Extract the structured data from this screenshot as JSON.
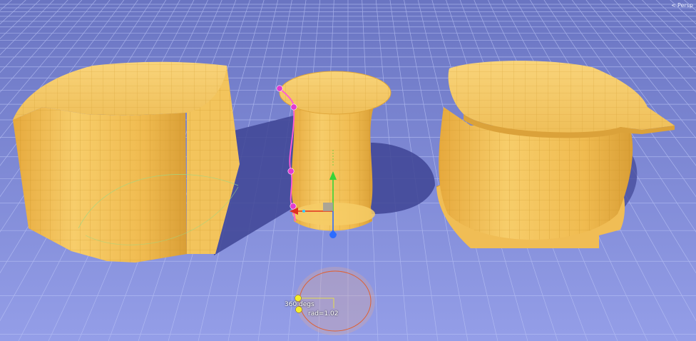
{
  "viewport": {
    "projection_label": "Persp",
    "projection_icon": "camera-arrow-icon"
  },
  "gizmo": {
    "angle_label": "360 degs",
    "radius_label": "rad=1.02"
  },
  "colors": {
    "sky_top": "#6a75c2",
    "sky_bottom": "#949ee8",
    "grid_line": "#b9c2f5",
    "mesh_fill": "#f1bd4f",
    "mesh_light": "#f8d479",
    "mesh_dark": "#d29833",
    "mesh_wire": "#c8921f",
    "shadow": "#3e4494",
    "profile_curve": "#ff5ad6",
    "handle_point": "#e23ad0",
    "gizmo_x": "#e03020",
    "gizmo_y": "#37d437",
    "gizmo_z": "#2c6cff",
    "gizmo_disc": "#d8a8a0",
    "gizmo_ring": "#e06030",
    "gizmo_handle": "#f5ee2a"
  }
}
